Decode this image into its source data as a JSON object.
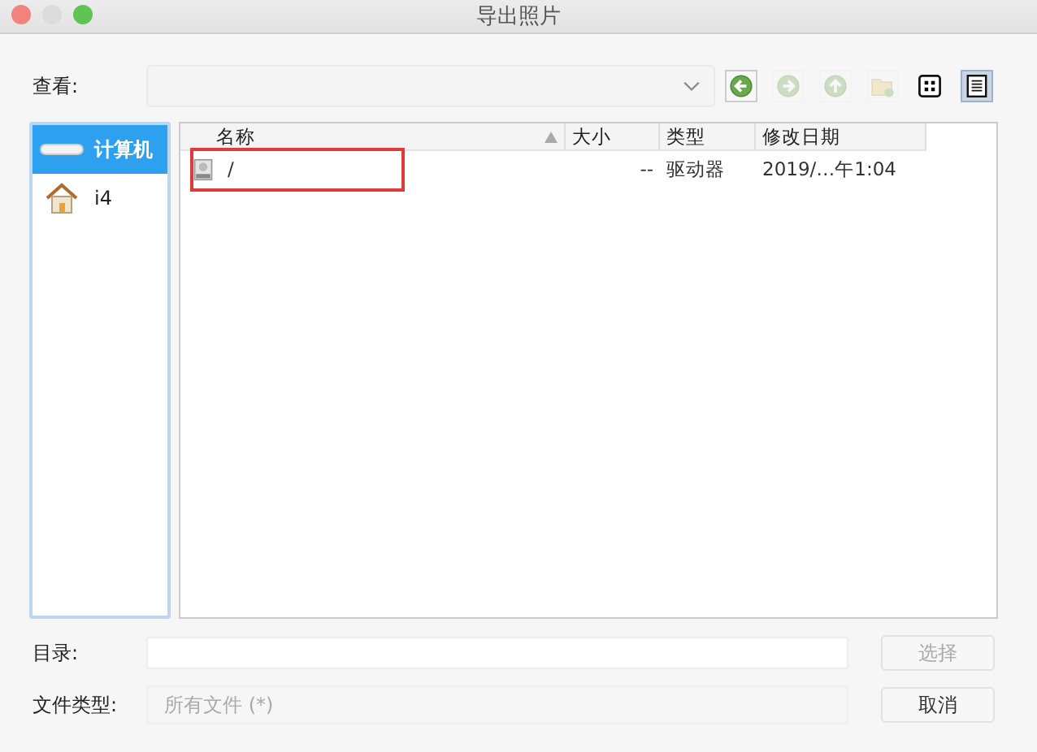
{
  "window": {
    "title": "导出照片"
  },
  "look_in": {
    "label": "查看:"
  },
  "toolbar": [
    {
      "kind": "back",
      "disabled": false
    },
    {
      "kind": "forward",
      "disabled": true
    },
    {
      "kind": "up",
      "disabled": true
    },
    {
      "kind": "new_folder",
      "disabled": true
    },
    {
      "kind": "icon_view",
      "selected": false
    },
    {
      "kind": "list_view",
      "selected": true
    }
  ],
  "sidebar": {
    "items": [
      {
        "label": "计算机",
        "kind": "computer",
        "selected": true
      },
      {
        "label": "i4",
        "kind": "home",
        "selected": false
      }
    ]
  },
  "table": {
    "columns": [
      {
        "label": "名称",
        "sorted": true
      },
      {
        "label": "大小",
        "sorted": false
      },
      {
        "label": "类型",
        "sorted": false
      },
      {
        "label": "修改日期",
        "sorted": false
      }
    ],
    "rows": [
      {
        "name": "/",
        "size": "--",
        "type": "驱动器",
        "modified": "2019/…午1:04",
        "highlighted": true
      }
    ]
  },
  "directory": {
    "label": "目录:",
    "button": "选择"
  },
  "file_type": {
    "label": "文件类型:",
    "value": "所有文件 (*)",
    "button": "取消"
  }
}
